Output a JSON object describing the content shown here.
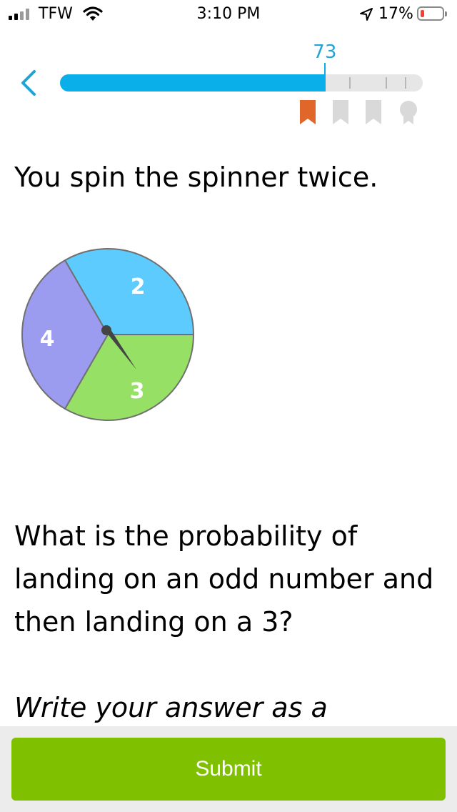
{
  "status_bar": {
    "carrier": "TFW",
    "time": "3:10 PM",
    "battery": "17%",
    "battery_level": 0.17
  },
  "progress": {
    "score": "73",
    "score_value": 73,
    "max": 100,
    "ticks": [
      80,
      90,
      100
    ],
    "awards": [
      {
        "icon": "bookmark-icon",
        "earned": true,
        "color": "#e0662a"
      },
      {
        "icon": "bookmark-icon",
        "earned": false,
        "color": "#d9d9d9"
      },
      {
        "icon": "bookmark-icon",
        "earned": false,
        "color": "#d9d9d9"
      },
      {
        "icon": "medal-icon",
        "earned": false,
        "color": "#d9d9d9"
      }
    ]
  },
  "problem": {
    "intro": "You spin the spinner twice.",
    "question": "What is the probability of landing on an odd number and then landing on a 3?",
    "instruction": "Write your answer as a"
  },
  "spinner": {
    "sections": [
      {
        "label": "2",
        "color": "#5ecbff"
      },
      {
        "label": "3",
        "color": "#96e066"
      },
      {
        "label": "4",
        "color": "#9b9cf0"
      }
    ],
    "pointer_color": "#444444"
  },
  "footer": {
    "submit_label": "Submit",
    "submit_color": "#7fc000"
  }
}
